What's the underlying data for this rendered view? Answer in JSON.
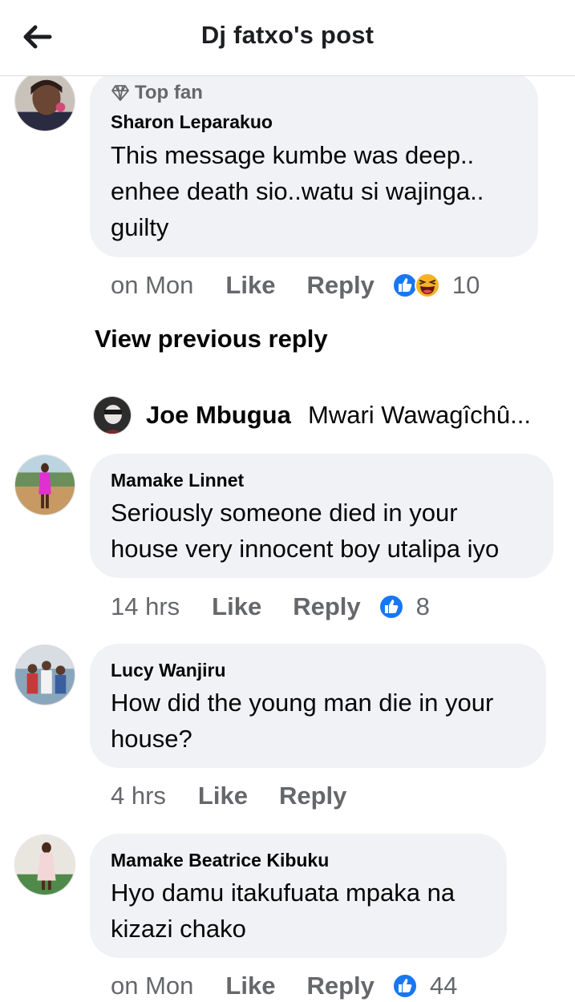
{
  "header": {
    "title": "Dj fatxo's post",
    "back_icon": "arrow-left-icon"
  },
  "comments": [
    {
      "badge": "Top fan",
      "author": "Sharon Leparakuo",
      "text": "This message kumbe was deep..\nenhee death sio..watu si wajinga..\nguilty",
      "time": "on Mon",
      "like": "Like",
      "reply": "Reply",
      "reactions": [
        "like-reaction-icon",
        "haha-reaction-icon"
      ],
      "reaction_count": "10"
    },
    {
      "author": "Mamake Linnet",
      "text": "Seriously someone died in your\nhouse very innocent boy utalipa iyo",
      "time": "14 hrs",
      "like": "Like",
      "reply": "Reply",
      "reactions": [
        "like-reaction-icon"
      ],
      "reaction_count": "8"
    },
    {
      "author": "Lucy Wanjiru",
      "text": "How did the young man die in your\nhouse?",
      "time": "4 hrs",
      "like": "Like",
      "reply": "Reply"
    },
    {
      "author": "Mamake Beatrice Kibuku",
      "text": "Hyo damu itakufuata mpaka na\nkizazi chako",
      "time": "on Mon",
      "like": "Like",
      "reply": "Reply",
      "reactions": [
        "like-reaction-icon"
      ],
      "reaction_count": "44"
    }
  ],
  "view_previous": "View previous reply",
  "reply_preview": {
    "name": "Joe Mbugua",
    "text": "Mwari Wawagîchû..."
  },
  "colors": {
    "bubble": "#f0f2f5",
    "secondary_text": "#65676b",
    "like_blue": "#1877f2",
    "haha_yellow": "#f7b125"
  }
}
